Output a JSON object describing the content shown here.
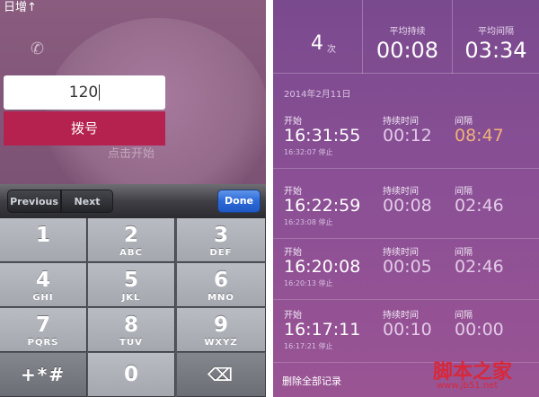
{
  "left": {
    "top_label": "日增↑",
    "dial_value": "120",
    "dial_button": "拨号",
    "hint": "点击开始",
    "accessory": {
      "previous": "Previous",
      "next": "Next",
      "done": "Done"
    },
    "keys": [
      {
        "num": "1",
        "letters": ""
      },
      {
        "num": "2",
        "letters": "ABC"
      },
      {
        "num": "3",
        "letters": "DEF"
      },
      {
        "num": "4",
        "letters": "GHI"
      },
      {
        "num": "5",
        "letters": "JKL"
      },
      {
        "num": "6",
        "letters": "MNO"
      },
      {
        "num": "7",
        "letters": "PQRS"
      },
      {
        "num": "8",
        "letters": "TUV"
      },
      {
        "num": "9",
        "letters": "WXYZ"
      },
      {
        "num": "+*#",
        "letters": ""
      },
      {
        "num": "0",
        "letters": ""
      },
      {
        "num": "⌫",
        "letters": ""
      }
    ],
    "colors": {
      "dial_button": "#b5224f",
      "done": "#2d6ad8"
    }
  },
  "right": {
    "summary": {
      "count": "4",
      "count_unit": "次",
      "avg_duration_label": "平均持续",
      "avg_duration": "00:08",
      "avg_interval_label": "平均间隔",
      "avg_interval": "03:34"
    },
    "date": "2014年2月11日",
    "headers": {
      "start": "开始",
      "duration": "持续时间",
      "interval": "间隔"
    },
    "records": [
      {
        "start": "16:31:55",
        "stop": "16:32:07 停止",
        "duration": "00:12",
        "interval": "08:47"
      },
      {
        "start": "16:22:59",
        "stop": "16:23:08 停止",
        "duration": "00:08",
        "interval": "02:46"
      },
      {
        "start": "16:20:08",
        "stop": "16:20:13 停止",
        "duration": "00:05",
        "interval": "02:46"
      },
      {
        "start": "16:17:11",
        "stop": "16:17:21 停止",
        "duration": "00:10",
        "interval": "00:00"
      }
    ],
    "clear_all": "删除全部记录",
    "watermark": "脚本之家",
    "watermark_url": "www.jb51.net",
    "colors": {
      "accent_interval": "#f0b27a",
      "watermark": "#d8283a"
    }
  }
}
